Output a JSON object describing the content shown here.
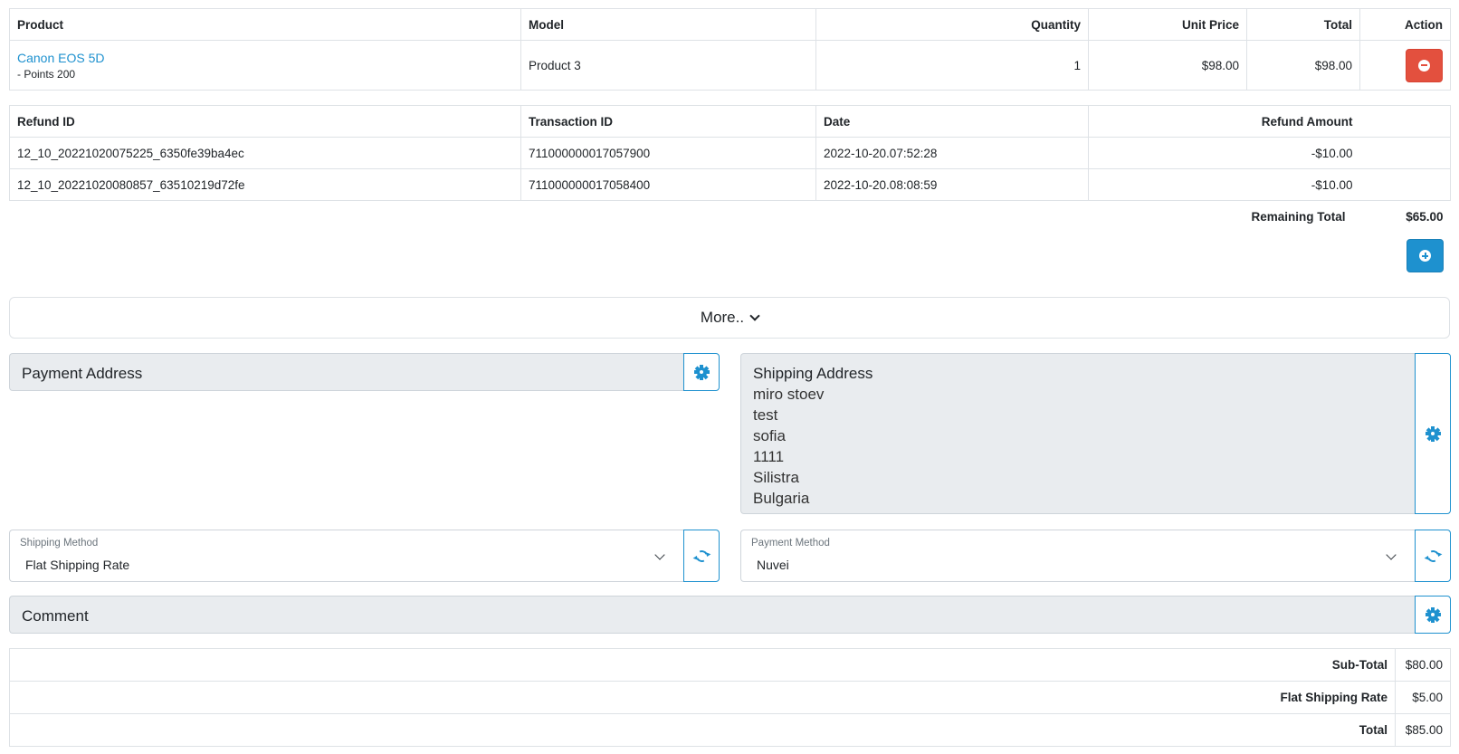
{
  "products": {
    "headers": {
      "product": "Product",
      "model": "Model",
      "quantity": "Quantity",
      "unit_price": "Unit Price",
      "total": "Total",
      "action": "Action"
    },
    "rows": [
      {
        "name": "Canon EOS 5D",
        "option": "- Points 200",
        "model": "Product 3",
        "quantity": "1",
        "unit_price": "$98.00",
        "total": "$98.00"
      }
    ]
  },
  "refunds": {
    "headers": {
      "refund_id": "Refund ID",
      "transaction_id": "Transaction ID",
      "date": "Date",
      "amount": "Refund Amount"
    },
    "rows": [
      {
        "refund_id": "12_10_20221020075225_6350fe39ba4ec",
        "transaction_id": "711000000017057900",
        "date": "2022-10-20.07:52:28",
        "amount": "-$10.00"
      },
      {
        "refund_id": "12_10_20221020080857_63510219d72fe",
        "transaction_id": "711000000017058400",
        "date": "2022-10-20.08:08:59",
        "amount": "-$10.00"
      }
    ],
    "remaining_label": "Remaining Total",
    "remaining_value": "$65.00"
  },
  "more_label": "More..",
  "payment_address": {
    "title": "Payment Address"
  },
  "shipping_address": {
    "title": "Shipping Address",
    "lines": [
      "miro stoev",
      "test",
      "sofia",
      "1111",
      "Silistra",
      "Bulgaria"
    ]
  },
  "shipping_method": {
    "label": "Shipping Method",
    "value": "Flat Shipping Rate"
  },
  "payment_method": {
    "label": "Payment Method",
    "value": "Nuvei"
  },
  "comment": {
    "title": "Comment"
  },
  "totals": [
    {
      "label": "Sub-Total",
      "value": "$80.00"
    },
    {
      "label": "Flat Shipping Rate",
      "value": "$5.00"
    },
    {
      "label": "Total",
      "value": "$85.00"
    }
  ],
  "colors": {
    "primary": "#1e91cf",
    "danger": "#e3503e",
    "panel": "#e9ecef"
  }
}
